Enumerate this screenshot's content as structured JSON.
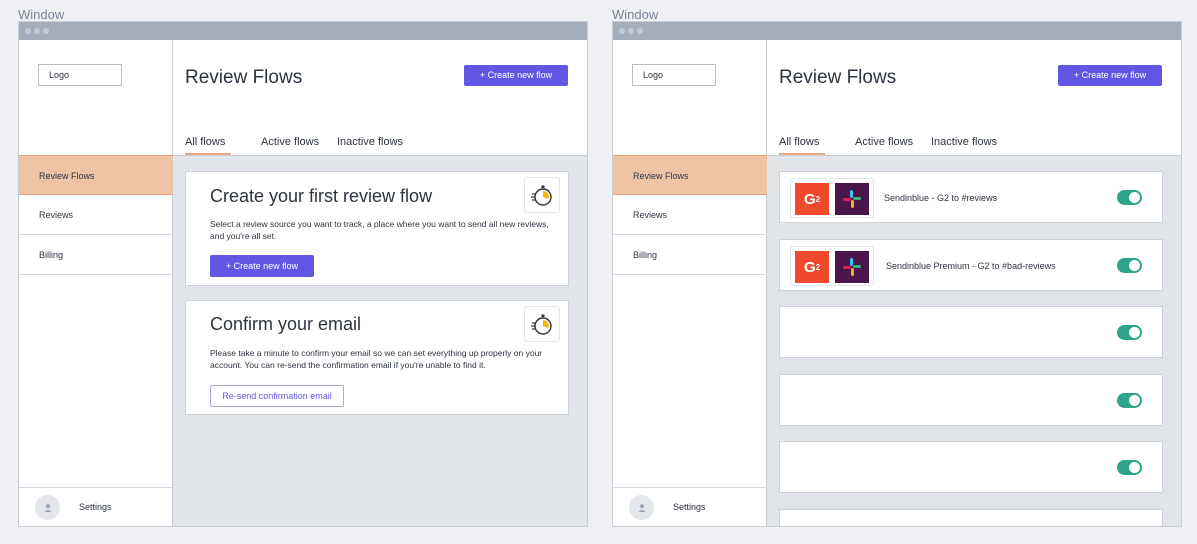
{
  "windows": [
    {
      "label": "Window",
      "logo": "Logo",
      "nav": [
        "Review Flows",
        "Reviews",
        "Billing"
      ],
      "settings": "Settings",
      "title": "Review Flows",
      "create_button": "+ Create new flow",
      "tabs": [
        "All flows",
        "Active flows",
        "Inactive flows"
      ],
      "cards": [
        {
          "title": "Create your first review flow",
          "body": "Select a review source you want to track, a place where you want to send all new reviews, and you're all set.",
          "button": "+ Create new flow"
        },
        {
          "title": "Confirm your email",
          "body": "Please take a minute to confirm your email so we can set everything up properly on your account. You can re-send the confirmation email if you're unable to find it.",
          "button": "Re-send confirmation email"
        }
      ]
    },
    {
      "label": "Window",
      "logo": "Logo",
      "nav": [
        "Review Flows",
        "Reviews",
        "Billing"
      ],
      "settings": "Settings",
      "title": "Review Flows",
      "create_button": "+ Create new flow",
      "tabs": [
        "All flows",
        "Active flows",
        "Inactive flows"
      ],
      "flows": [
        {
          "name": "Sendinblue - G2 to #reviews",
          "enabled": true
        },
        {
          "name": "Sendinblue Premium - G2 to #bad-reviews",
          "enabled": true
        },
        {
          "name": "",
          "enabled": true
        },
        {
          "name": "",
          "enabled": true
        },
        {
          "name": "",
          "enabled": true
        },
        {
          "name": "",
          "enabled": true
        }
      ]
    }
  ],
  "colors": {
    "accent": "#6356e5",
    "active_nav": "#eec4a5",
    "toggle_on": "#2ea58a",
    "g2": "#ef4a2e",
    "slack_bg": "#4a154b"
  },
  "icons": {
    "g2_letter": "G",
    "g2_sup": "2"
  }
}
